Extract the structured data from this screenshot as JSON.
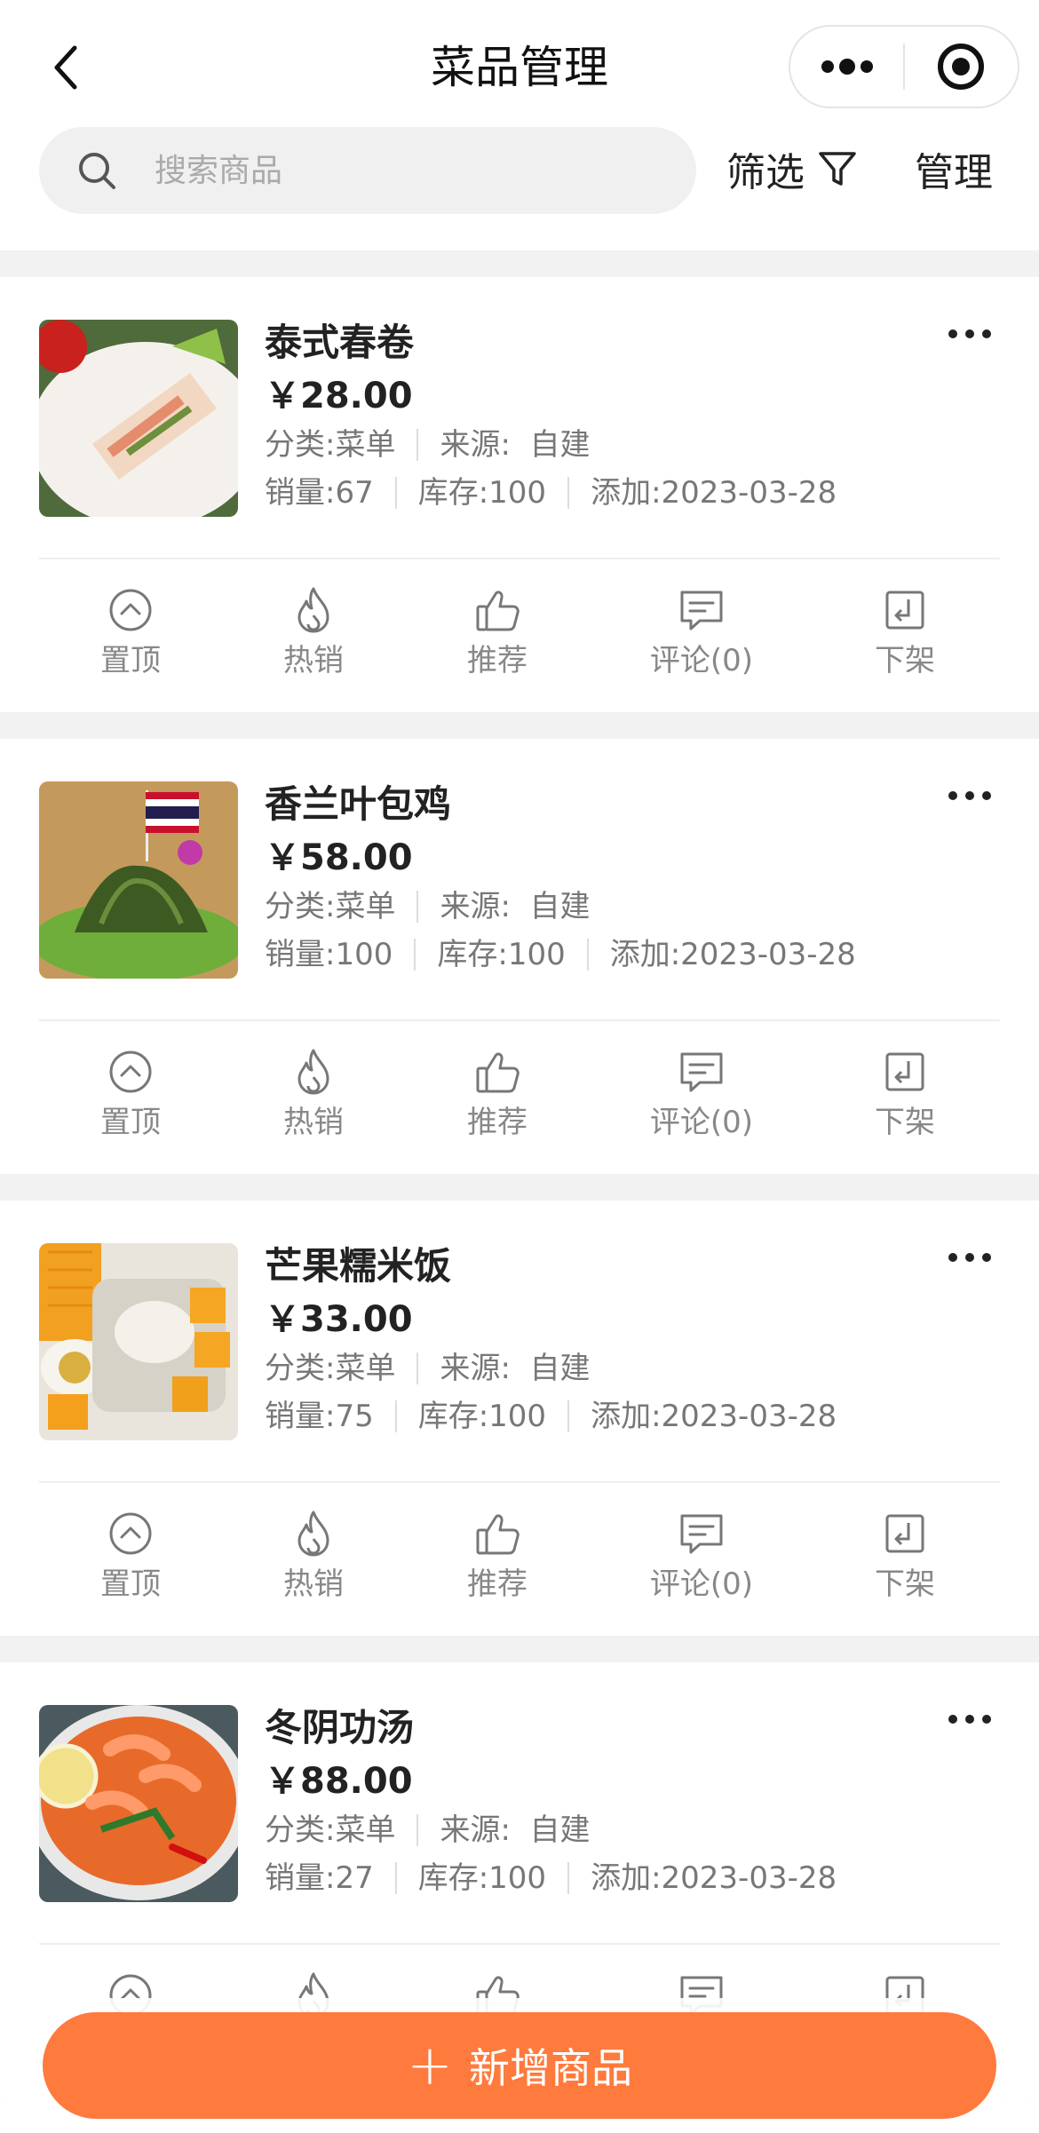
{
  "header": {
    "title": "菜品管理"
  },
  "search": {
    "placeholder": "搜索商品"
  },
  "toolbar": {
    "filter_label": "筛选",
    "manage_label": "管理"
  },
  "products": [
    {
      "name": "泰式春卷",
      "price": "￥28.00",
      "category": "分类:菜单",
      "source": "来源:  自建",
      "sales": "销量:67",
      "stock": "库存:100",
      "added": "添加:2023-03-28"
    },
    {
      "name": "香兰叶包鸡",
      "price": "￥58.00",
      "category": "分类:菜单",
      "source": "来源:  自建",
      "sales": "销量:100",
      "stock": "库存:100",
      "added": "添加:2023-03-28"
    },
    {
      "name": "芒果糯米饭",
      "price": "￥33.00",
      "category": "分类:菜单",
      "source": "来源:  自建",
      "sales": "销量:75",
      "stock": "库存:100",
      "added": "添加:2023-03-28"
    },
    {
      "name": "冬阴功汤",
      "price": "￥88.00",
      "category": "分类:菜单",
      "source": "来源:  自建",
      "sales": "销量:27",
      "stock": "库存:100",
      "added": "添加:2023-03-28"
    }
  ],
  "actions": {
    "pin": "置顶",
    "hot": "热销",
    "recommend": "推荐",
    "comments": "评论(0)",
    "delist": "下架"
  },
  "footer": {
    "add_label": "新增商品"
  },
  "colors": {
    "accent": "#ff7a3d"
  }
}
